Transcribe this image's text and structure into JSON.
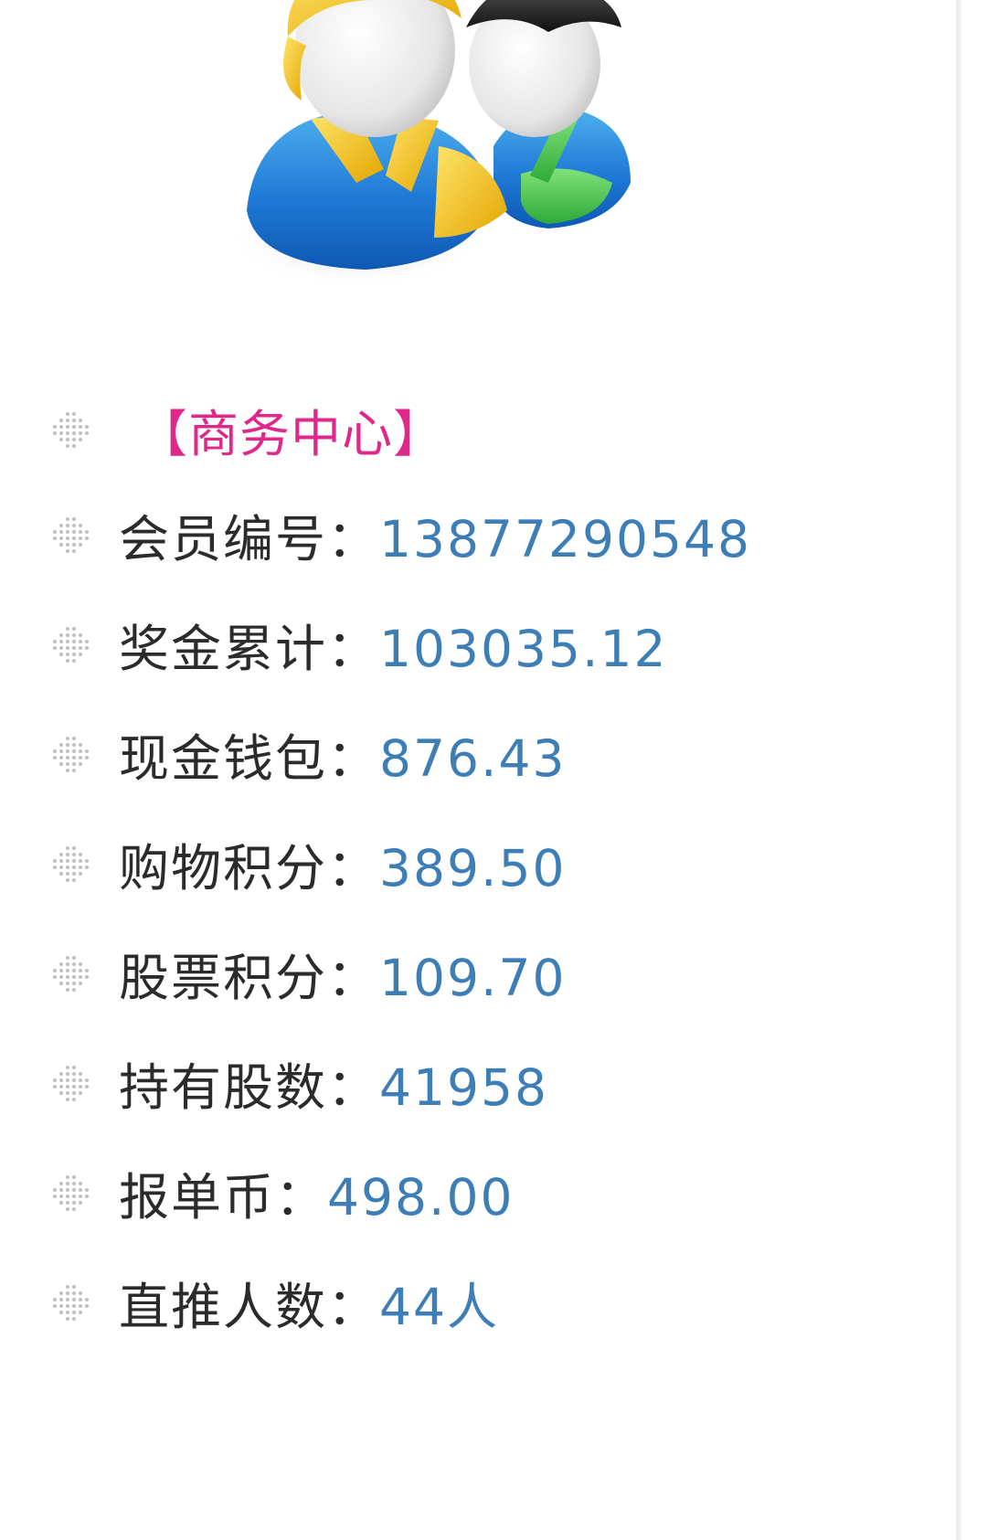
{
  "avatar": {
    "icon": "users-group-icon"
  },
  "business_center": {
    "title": "【商务中心】"
  },
  "rows": [
    {
      "label": "会员编号：",
      "value": "13877290548"
    },
    {
      "label": "奖金累计：",
      "value": "103035.12"
    },
    {
      "label": "现金钱包：",
      "value": "876.43"
    },
    {
      "label": "购物积分：",
      "value": "389.50"
    },
    {
      "label": "股票积分：",
      "value": "109.70"
    },
    {
      "label": "持有股数：",
      "value": "41958"
    },
    {
      "label": "报单币：",
      "value": "498.00"
    },
    {
      "label": "直推人数：",
      "value": "44人"
    }
  ],
  "colors": {
    "title": "#e0288a",
    "value": "#3e7eb6",
    "label": "#2b2b2b"
  }
}
